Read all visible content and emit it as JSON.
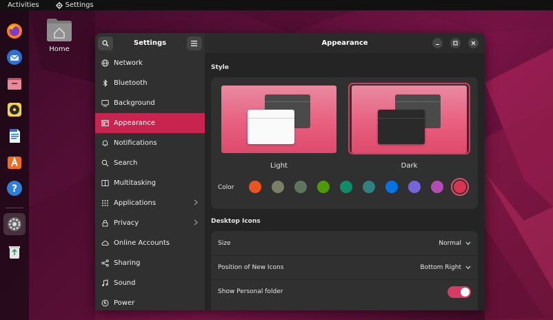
{
  "topbar": {
    "activities": "Activities",
    "app_name": "Settings"
  },
  "desktop": {
    "home_label": "Home"
  },
  "dock": {
    "items": [
      "firefox-icon",
      "thunderbird-icon",
      "files-icon",
      "rhythmbox-icon",
      "libreoffice-writer-icon",
      "app-center-icon",
      "help-icon",
      "settings-icon",
      "trash-icon"
    ]
  },
  "sidebar": {
    "title": "Settings",
    "items": [
      {
        "label": "Network",
        "icon": "network-icon"
      },
      {
        "label": "Bluetooth",
        "icon": "bluetooth-icon"
      },
      {
        "label": "Background",
        "icon": "background-icon"
      },
      {
        "label": "Appearance",
        "icon": "appearance-icon",
        "selected": true
      },
      {
        "label": "Notifications",
        "icon": "bell-icon"
      },
      {
        "label": "Search",
        "icon": "search-icon"
      },
      {
        "label": "Multitasking",
        "icon": "multitasking-icon"
      },
      {
        "label": "Applications",
        "icon": "apps-icon",
        "has_chevron": true
      },
      {
        "label": "Privacy",
        "icon": "lock-icon",
        "has_chevron": true
      },
      {
        "label": "Online Accounts",
        "icon": "cloud-icon"
      },
      {
        "label": "Sharing",
        "icon": "share-icon"
      },
      {
        "label": "Sound",
        "icon": "music-icon"
      },
      {
        "label": "Power",
        "icon": "power-icon"
      }
    ]
  },
  "main": {
    "title": "Appearance",
    "style": {
      "section_title": "Style",
      "light_label": "Light",
      "dark_label": "Dark",
      "selected": "Dark",
      "color_label": "Color",
      "colors": [
        "#e95420",
        "#7c7f66",
        "#5f7560",
        "#4e9a06",
        "#0e8c6c",
        "#308280",
        "#0073e5",
        "#7764d8",
        "#b34cb3",
        "#da3450"
      ],
      "selected_color": "#da3450"
    },
    "desktop_icons": {
      "section_title": "Desktop Icons",
      "size_label": "Size",
      "size_value": "Normal",
      "position_label": "Position of New Icons",
      "position_value": "Bottom Right",
      "show_personal_label": "Show Personal folder",
      "show_personal_on": true
    }
  }
}
